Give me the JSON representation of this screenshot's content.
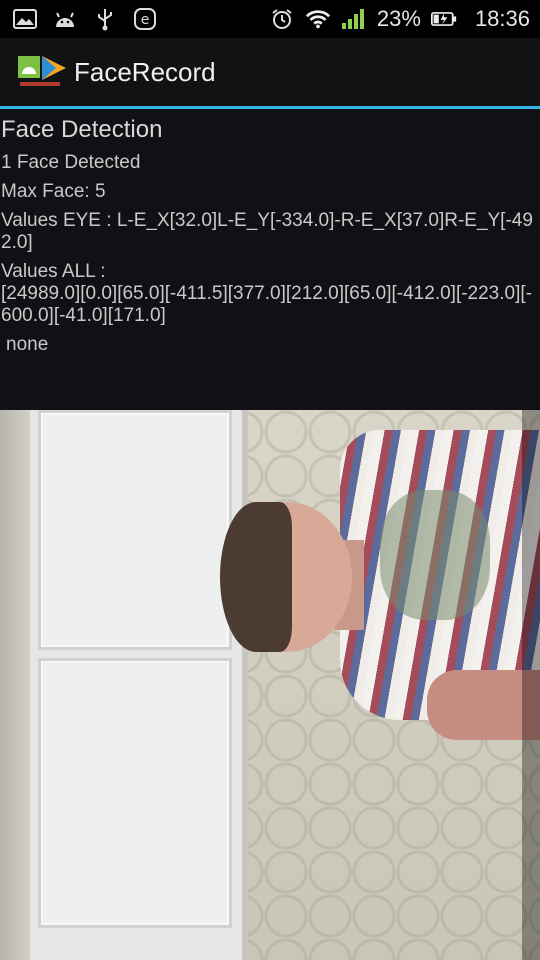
{
  "status_bar": {
    "left_icons": [
      "image-icon",
      "android-icon",
      "usb-icon",
      "e-circle-icon"
    ],
    "right_icons": [
      "alarm-icon",
      "wifi-icon",
      "signal-icon"
    ],
    "battery_percent": "23%",
    "battery_icon": "battery-charging-icon",
    "time": "18:36"
  },
  "action_bar": {
    "title": "FaceRecord",
    "logo_icon": "app-logo-icon",
    "accent_color": "#33b5e5"
  },
  "info": {
    "heading": "Face Detection",
    "faces_detected": "1 Face Detected",
    "max_face": "Max Face: 5",
    "values_eye": "Values EYE : L-E_X[32.0]L-E_Y[-334.0]-R-E_X[37.0]R-E_Y[-492.0]",
    "values_all_label": "Values ALL :",
    "values_all": "[24989.0][0.0][65.0][-411.5][377.0][212.0][65.0][-412.0][-223.0][-600.0][-41.0][171.0]",
    "status": "none"
  },
  "camera_preview": {
    "description_icon": "camera-preview"
  }
}
